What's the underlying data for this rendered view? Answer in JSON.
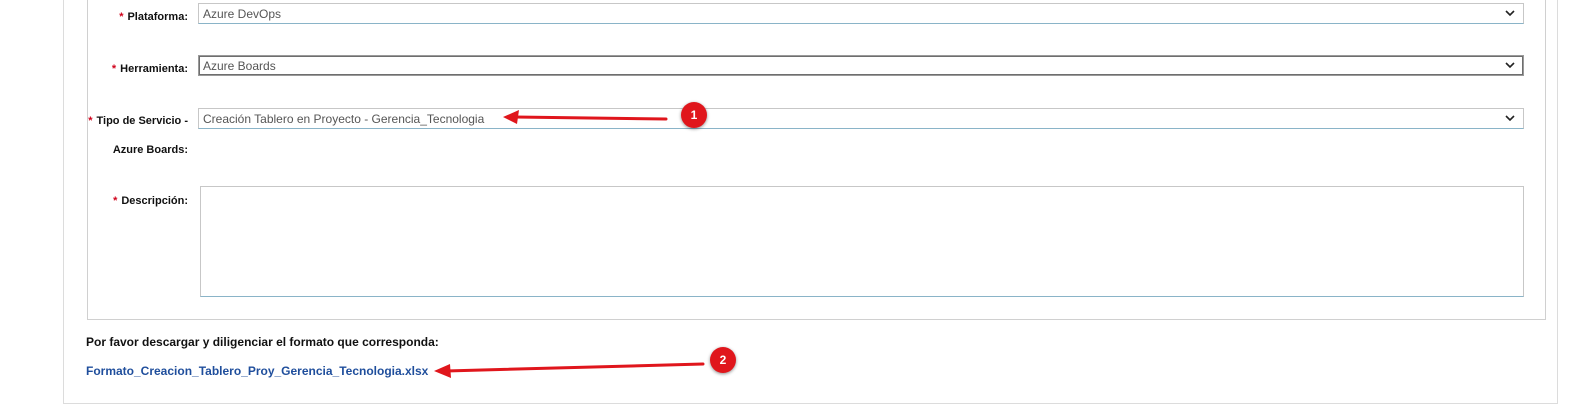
{
  "form": {
    "plataforma": {
      "label": "Plataforma:",
      "value": "Azure DevOps"
    },
    "herramienta": {
      "label": "Herramienta:",
      "value": "Azure Boards"
    },
    "tipo_servicio": {
      "label_line1": "Tipo de Servicio -",
      "label_line2": "Azure Boards:",
      "value": "Creación Tablero en Proyecto - Gerencia_Tecnologia"
    },
    "descripcion": {
      "label": "Descripción:",
      "value": ""
    },
    "required_mark": "*"
  },
  "download": {
    "instruction": "Por favor descargar y diligenciar el formato que corresponda:",
    "file_link": "Formato_Creacion_Tablero_Proy_Gerencia_Tecnologia.xlsx"
  },
  "annotations": {
    "badge_1": "1",
    "badge_2": "2",
    "arrow_color": "#e0161c"
  },
  "icons": {
    "dropdown": "chevron-down-icon"
  }
}
